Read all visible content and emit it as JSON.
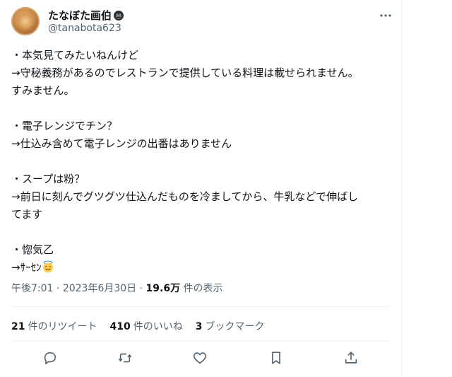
{
  "author": {
    "display_name": "たなぼた画伯",
    "handle": "@tanabota623",
    "badge_icon": "gorilla-icon",
    "avatar": "food-photo-avatar"
  },
  "tweet": {
    "lines": [
      "・本気見てみたいねんけど",
      "→守秘義務があるのでレストランで提供している料理は載せられません。",
      "すみません。",
      "",
      "・電子レンジでチン？",
      "→仕込み含めて電子レンジの出番はありません",
      "",
      "・スープは粉？",
      "→前日に刻んでグツグツ仕込んだものを冷ましてから、牛乳などで伸ばし",
      "てます",
      "",
      "・惚気乙",
      "→ｻｰｾﾝ"
    ],
    "last_line_emoji": "smiling-face-with-halo-icon"
  },
  "meta": {
    "time": "午後7:01",
    "sep1": " · ",
    "date": "2023年6月30日",
    "sep2": " · ",
    "views_count": "19.6万",
    "views_label": " 件の表示"
  },
  "stats": {
    "retweets_count": "21",
    "retweets_label": "件のリツイート",
    "likes_count": "410",
    "likes_label": "件のいいね",
    "bookmarks_count": "3",
    "bookmarks_label": "ブックマーク"
  },
  "colors": {
    "text": "#0f1419",
    "secondary": "#536471",
    "border": "#eff3f4"
  }
}
